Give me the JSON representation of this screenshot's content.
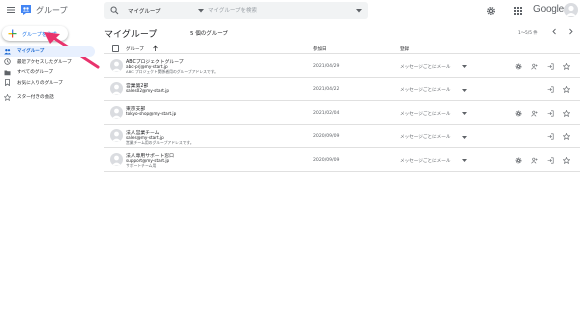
{
  "app": {
    "title": "グループ",
    "google_logo": "Google"
  },
  "search": {
    "scope": "マイグループ",
    "placeholder": "マイグループを検索"
  },
  "create_button": {
    "label": "グループを作成"
  },
  "sidebar": {
    "items": [
      {
        "label": "マイグループ",
        "icon": "people-icon",
        "active": true
      },
      {
        "label": "最近アクセスしたグループ",
        "icon": "clock-icon",
        "active": false
      },
      {
        "label": "すべてのグループ",
        "icon": "folder-icon",
        "active": false
      },
      {
        "label": "お気に入りのグループ",
        "icon": "bookmark-icon",
        "active": false
      },
      {
        "label": "スター付きの会話",
        "icon": "star-icon",
        "active": false
      }
    ]
  },
  "main": {
    "heading": "マイグループ",
    "count": "5 個のグループ",
    "pagination": "1～5/5 件",
    "columns": {
      "group": "グループ",
      "joined": "参加日",
      "subscription": "登録"
    },
    "rows": [
      {
        "name": "ABCプロジェクトグループ",
        "email": "abc-prj@my-start.jp",
        "description": "ABC プロジェクト関係者用のグループアドレスです。",
        "joined": "2021/04/29",
        "subscription": "メッセージごとにメール",
        "icons": [
          "settings-icon",
          "manage-members-icon",
          "leave-group-icon",
          "star-icon"
        ]
      },
      {
        "name": "営業第2部",
        "email": "sales02@my-start.jp",
        "description": "",
        "joined": "2021/04/22",
        "subscription": "メッセージごとにメール",
        "icons": [
          "leave-group-icon",
          "star-icon"
        ]
      },
      {
        "name": "東京支部",
        "email": "tokyo-shop@my-start.jp",
        "description": "",
        "joined": "2021/02/04",
        "subscription": "メッセージごとにメール",
        "icons": [
          "settings-icon",
          "manage-members-icon",
          "leave-group-icon",
          "star-icon"
        ]
      },
      {
        "name": "法人営業チーム",
        "email": "sales@my-start.jp",
        "description": "営業チーム用のグループアドレスです。",
        "joined": "2020/09/09",
        "subscription": "メッセージごとにメール",
        "icons": [
          "leave-group-icon",
          "star-icon"
        ]
      },
      {
        "name": "法人専用サポート窓口",
        "email": "support@my-start.jp",
        "description": "サポートチーム用",
        "joined": "2020/09/09",
        "subscription": "メッセージごとにメール",
        "icons": [
          "settings-icon",
          "manage-members-icon",
          "leave-group-icon",
          "star-icon"
        ]
      }
    ]
  },
  "colors": {
    "accent": "#1a73e8",
    "active_bg": "#e8f0fe",
    "arrow": "#e8336d",
    "divider": "#e0e0e0"
  }
}
